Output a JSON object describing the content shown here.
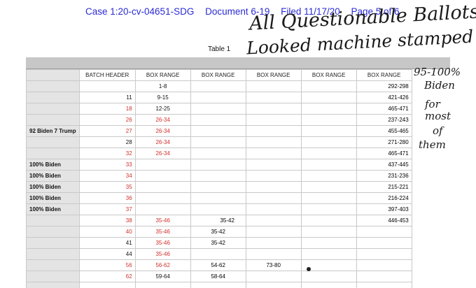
{
  "header": {
    "case": "Case 1:20-cv-04651-SDG",
    "document": "Document 6-19",
    "filed": "Filed 11/17/20",
    "page": "Page 5 of 6"
  },
  "table_title": "Table 1",
  "columns": [
    "",
    "BATCH HEADER",
    "BOX RANGE",
    "BOX RANGE",
    "BOX RANGE",
    "BOX RANGE",
    "BOX RANGE"
  ],
  "rows": [
    {
      "label": "",
      "batch": "",
      "batch_color": "#111111",
      "box1": "1-8",
      "box1_color": "#111111",
      "box2": "",
      "box3": "",
      "box4": "",
      "box5": "292-298"
    },
    {
      "label": "",
      "batch": "11",
      "batch_color": "#111111",
      "box1": "9-15",
      "box1_color": "#111111",
      "box2": "",
      "box3": "",
      "box4": "",
      "box5": "421-426"
    },
    {
      "label": "",
      "batch": "18",
      "batch_color": "#d0302c",
      "box1": "12-25",
      "box1_color": "#111111",
      "box2": "",
      "box3": "",
      "box4": "",
      "box5": "465-471"
    },
    {
      "label": "",
      "batch": "26",
      "batch_color": "#d0302c",
      "box1": "26-34",
      "box1_color": "#d0302c",
      "box2": "",
      "box3": "",
      "box4": "",
      "box5": "237-243"
    },
    {
      "label": "92 Biden 7 Trump",
      "batch": "27",
      "batch_color": "#d0302c",
      "box1": "26-34",
      "box1_color": "#d0302c",
      "box2": "",
      "box3": "",
      "box4": "",
      "box5": "455-465"
    },
    {
      "label": "",
      "batch": "28",
      "batch_color": "#111111",
      "box1": "26-34",
      "box1_color": "#d0302c",
      "box2": "",
      "box3": "",
      "box4": "",
      "box5": "271-280"
    },
    {
      "label": "",
      "batch": "32",
      "batch_color": "#d0302c",
      "box1": "26-34",
      "box1_color": "#d0302c",
      "box2": "",
      "box3": "",
      "box4": "",
      "box5": "465-471"
    },
    {
      "label": "100% Biden",
      "batch": "33",
      "batch_color": "#d0302c",
      "box1": "",
      "box1_color": "#111111",
      "box2": "",
      "box3": "",
      "box4": "",
      "box5": "437-445"
    },
    {
      "label": "100% Biden",
      "batch": "34",
      "batch_color": "#d0302c",
      "box1": "",
      "box1_color": "#111111",
      "box2": "",
      "box3": "",
      "box4": "",
      "box5": "231-236"
    },
    {
      "label": "100% Biden",
      "batch": "35",
      "batch_color": "#d0302c",
      "box1": "",
      "box1_color": "#111111",
      "box2": "",
      "box3": "",
      "box4": "",
      "box5": "215-221"
    },
    {
      "label": "100% Biden",
      "batch": "36",
      "batch_color": "#d0302c",
      "box1": "",
      "box1_color": "#111111",
      "box2": "",
      "box3": "",
      "box4": "",
      "box5": "216-224"
    },
    {
      "label": "100% Biden",
      "batch": "37",
      "batch_color": "#d0302c",
      "box1": "",
      "box1_color": "#111111",
      "box2": "",
      "box3": "",
      "box4": "",
      "box5": "397-403"
    },
    {
      "label": "",
      "batch": "38",
      "batch_color": "#d0302c",
      "box1": "35-46",
      "box1_color": "#d0302c",
      "box2": "35-42",
      "box3": "",
      "box4": "",
      "box5": "446-453"
    },
    {
      "label": "",
      "batch": "40",
      "batch_color": "#d0302c",
      "box1": "35-46",
      "box1_color": "#d0302c",
      "box2": "35-42",
      "box3": "",
      "box4": "",
      "box5": ""
    },
    {
      "label": "",
      "batch": "41",
      "batch_color": "#111111",
      "box1": "35-46",
      "box1_color": "#d0302c",
      "box2": "35-42",
      "box3": "",
      "box4": "",
      "box5": ""
    },
    {
      "label": "",
      "batch": "44",
      "batch_color": "#111111",
      "box1": "35-46",
      "box1_color": "#d0302c",
      "box2": "",
      "box3": "",
      "box4": "",
      "box5": ""
    },
    {
      "label": "",
      "batch": "56",
      "batch_color": "#d0302c",
      "box1": "56-62",
      "box1_color": "#d0302c",
      "box2": "54-62",
      "box3": "73-80",
      "box4": "",
      "box5": ""
    },
    {
      "label": "",
      "batch": "62",
      "batch_color": "#d0302c",
      "box1": "59-64",
      "box1_color": "#111111",
      "box2": "58-64",
      "box3": "",
      "box4": "",
      "box5": ""
    },
    {
      "label": "",
      "batch": "",
      "batch_color": "#d0302c",
      "box1": "",
      "box1_color": "#d0302c",
      "box2": "",
      "box3": "",
      "box4": "",
      "box5": ""
    }
  ],
  "handwriting": {
    "line1": "All Questionable Ballots",
    "line2": "Looked machine stamped",
    "side": [
      "95-100%",
      "Biden",
      "for",
      "most",
      "of",
      "them"
    ]
  }
}
